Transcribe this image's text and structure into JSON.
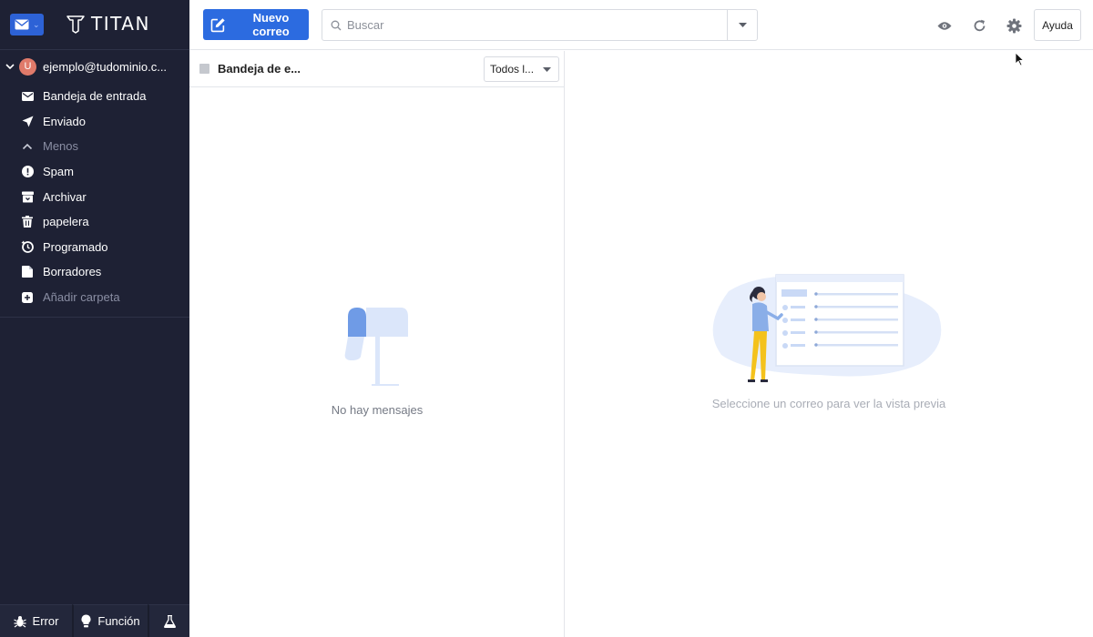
{
  "app": {
    "logo_text": "TITAN"
  },
  "account": {
    "avatar_letter": "U",
    "email": "ejemplo@tudominio.c..."
  },
  "folders": [
    {
      "label": "Bandeja de entrada",
      "icon": "envelope-icon"
    },
    {
      "label": "Enviado",
      "icon": "paper-plane-icon"
    },
    {
      "label": "Menos",
      "icon": "chevron-up-icon"
    },
    {
      "label": "Spam",
      "icon": "alert-circle-icon"
    },
    {
      "label": "Archivar",
      "icon": "archive-icon"
    },
    {
      "label": "papelera",
      "icon": "trash-icon"
    },
    {
      "label": "Programado",
      "icon": "clock-icon"
    },
    {
      "label": "Borradores",
      "icon": "draft-icon"
    },
    {
      "label": "Añadir carpeta",
      "icon": "plus-square-icon"
    }
  ],
  "bottom_bar": {
    "bug_label": "Error",
    "feature_label": "Función"
  },
  "toolbar": {
    "new_mail_label": "Nuevo correo",
    "search_placeholder": "Buscar",
    "help_label": "Ayuda"
  },
  "list": {
    "folder_title": "Bandeja de e...",
    "filter_label": "Todos l...",
    "empty_text": "No hay mensajes"
  },
  "preview": {
    "empty_text": "Seleccione un correo para ver la vista previa"
  },
  "colors": {
    "sidebar_bg": "#1e2134",
    "accent": "#2c6be0",
    "avatar": "#e07a6a"
  }
}
